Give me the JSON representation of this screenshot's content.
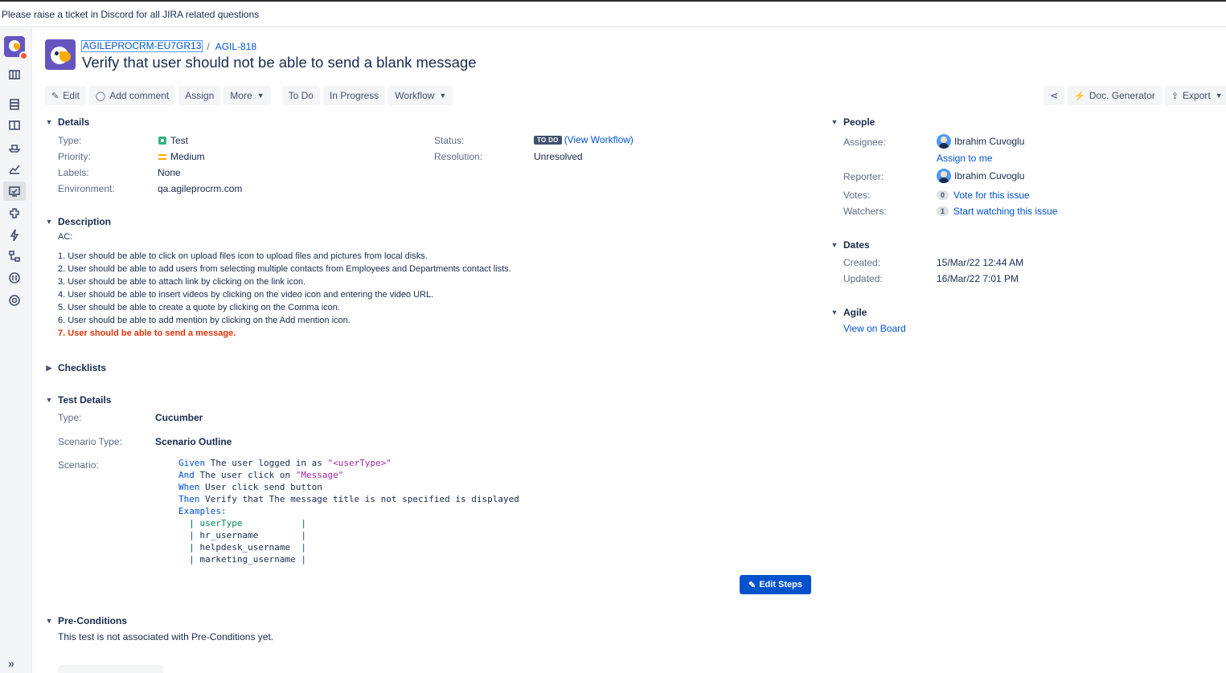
{
  "banner": "Please raise a ticket in Discord for all JIRA related questions",
  "breadcrumb": {
    "project": "AGILEPROCRM-EU7GR13",
    "separator": "/",
    "issue_key": "AGIL-818"
  },
  "issue": {
    "title": "Verify that user should not be able to send a blank message"
  },
  "toolbar": {
    "edit": "Edit",
    "add_comment": "Add comment",
    "assign": "Assign",
    "more": "More",
    "todo": "To Do",
    "in_progress": "In Progress",
    "workflow": "Workflow",
    "doc_generator": "Doc. Generator",
    "export": "Export"
  },
  "details": {
    "heading": "Details",
    "type_label": "Type:",
    "type_value": "Test",
    "priority_label": "Priority:",
    "priority_value": "Medium",
    "labels_label": "Labels:",
    "labels_value": "None",
    "environment_label": "Environment:",
    "environment_value": "qa.agileprocrm.com",
    "status_label": "Status:",
    "status_value": "TO DO",
    "status_link": "(View Workflow)",
    "resolution_label": "Resolution:",
    "resolution_value": "Unresolved"
  },
  "description": {
    "heading": "Description",
    "intro": "AC:",
    "items": [
      "1. User should be able to click on upload files icon to upload files and pictures from local disks.",
      "2. User should be able to add users from selecting multiple contacts from Employees and Departments contact lists.",
      "3. User should be able to attach link by clicking on the link icon.",
      "4. User should be able to insert videos by clicking on the video icon and entering the video URL.",
      "5. User should be able to create a quote by clicking on the Comma icon.",
      "6. User should be able to add mention by clicking on the Add mention icon.",
      "7. User should be able to send a message."
    ]
  },
  "checklists": {
    "heading": "Checklists"
  },
  "test_details": {
    "heading": "Test Details",
    "type_label": "Type:",
    "type_value": "Cucumber",
    "scenario_type_label": "Scenario Type:",
    "scenario_type_value": "Scenario Outline",
    "scenario_label": "Scenario:",
    "scenario": {
      "given_kw": "Given",
      "given_text": " The user logged in as ",
      "given_str": "\"<userType>\"",
      "and_kw": "And",
      "and_text": " The user click on ",
      "and_str": "\"Message\"",
      "when_kw": "When",
      "when_text": " User click send button",
      "then_kw": "Then",
      "then_text": " Verify that The message title is not specified is displayed",
      "examples_kw": "Examples:",
      "table_header": "userType",
      "table_rows": [
        "hr_username",
        "helpdesk_username",
        "marketing_username"
      ]
    },
    "edit_steps": "Edit Steps"
  },
  "pre_conditions": {
    "heading": "Pre-Conditions",
    "text": "This test is not associated with Pre-Conditions yet."
  },
  "people": {
    "heading": "People",
    "assignee_label": "Assignee:",
    "assignee_name": "Ibrahim Cuvoglu",
    "assign_to_me": "Assign to me",
    "reporter_label": "Reporter:",
    "reporter_name": "Ibrahim Cuvoglu",
    "votes_label": "Votes:",
    "votes_count": "0",
    "vote_link": "Vote for this issue",
    "watchers_label": "Watchers:",
    "watchers_count": "1",
    "watch_link": "Start watching this issue"
  },
  "dates": {
    "heading": "Dates",
    "created_label": "Created:",
    "created_value": "15/Mar/22 12:44 AM",
    "updated_label": "Updated:",
    "updated_value": "16/Mar/22 7:01 PM"
  },
  "agile": {
    "heading": "Agile",
    "view_on_board": "View on Board"
  },
  "sidebar_icons": [
    "project-avatar",
    "backlog-icon",
    "releases-icon",
    "board-icon",
    "ship-icon",
    "reports-icon",
    "tests-icon",
    "components-icon",
    "automation-icon",
    "structure-icon",
    "archive-icon",
    "settings-icon"
  ],
  "colors": {
    "link": "#0052cc",
    "ac_highlight": "#de350b",
    "primary_button": "#0052cc",
    "status_lozenge": "#42526e"
  }
}
